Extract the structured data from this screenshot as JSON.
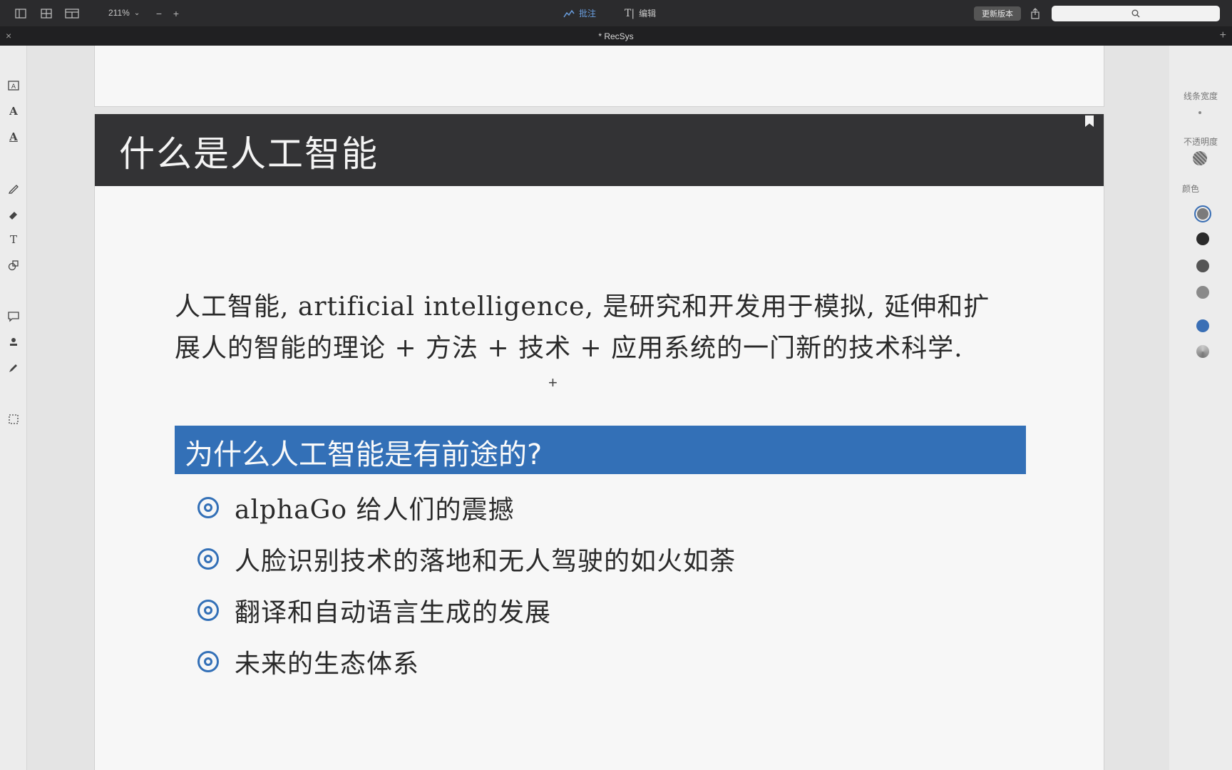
{
  "toolbar": {
    "zoom": "211%",
    "annotate_label": "批注",
    "edit_label": "编辑",
    "upgrade_label": "更新版本"
  },
  "tab": {
    "title": "* RecSys"
  },
  "properties": {
    "line_width_label": "线条宽度",
    "opacity_label": "不透明度",
    "color_label": "颜色",
    "colors": [
      "#7b7b7b",
      "#2b2b2b",
      "#555555",
      "#8a8a8a",
      "#3a6fb5",
      "#c9c9c9"
    ]
  },
  "slide": {
    "title": "什么是人工智能",
    "paragraph": "人工智能, artificial intelligence, 是研究和开发用于模拟, 延伸和扩展人的智能的理论 + 方法 + 技术 + 应用系统的一门新的技术科学.",
    "section_title": "为什么人工智能是有前途的?",
    "bullets": [
      "alphaGo 给人们的震撼",
      "人脸识别技术的落地和无人驾驶的如火如荼",
      "翻译和自动语言生成的发展",
      "未来的生态体系"
    ]
  },
  "theme": {
    "header_bg": "#333335",
    "accent_blue": "#3370b7"
  }
}
